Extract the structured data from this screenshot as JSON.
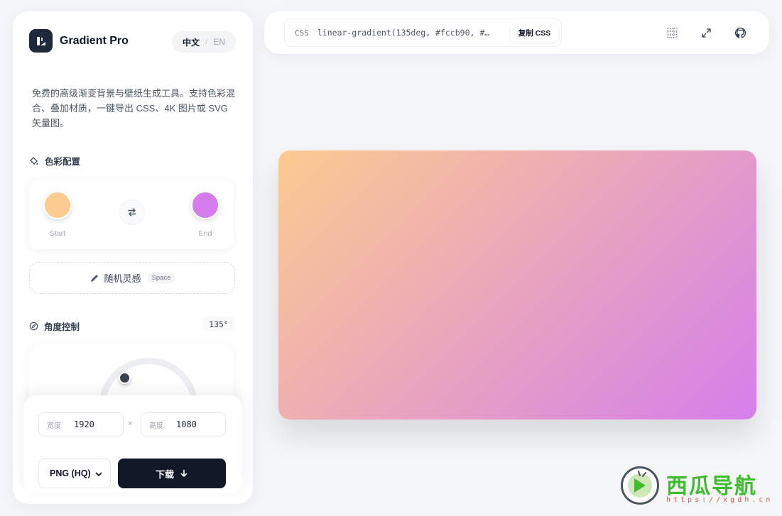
{
  "brand": {
    "name": "Gradient Pro"
  },
  "language": {
    "zh": "中文",
    "en": "EN",
    "active": "zh"
  },
  "description": "免费的高级渐变背景与壁纸生成工具。支持色彩混合、叠加材质，一键导出 CSS、4K 图片或 SVG 矢量图。",
  "color_config": {
    "title": "色彩配置",
    "start": {
      "label": "Start",
      "color": "#fccb90"
    },
    "end": {
      "label": "End",
      "color": "#d57eeb"
    }
  },
  "random": {
    "label": "随机灵感",
    "shortcut": "Space"
  },
  "angle": {
    "title": "角度控制",
    "value_text": "135°",
    "degrees": 135
  },
  "export": {
    "width_label": "宽度",
    "width_value": "1920",
    "height_label": "高度",
    "height_value": "1080",
    "times": "×",
    "format": "PNG (HQ)",
    "download_label": "下载"
  },
  "topbar": {
    "code_tag": "CSS",
    "code_text": "linear-gradient(135deg, #fccb90, #…",
    "copy_label": "复制 CSS"
  },
  "preview": {
    "gradient": "linear-gradient(135deg, #fccb90 0%, #d57eeb 100%)"
  },
  "watermark": {
    "title": "西瓜导航",
    "url": "https://xgdh.cn"
  },
  "icons": [
    "palette-icon",
    "swap-icon",
    "pencil-icon",
    "compass-icon",
    "chevron-down-icon",
    "arrow-down-icon",
    "grid-icon",
    "expand-icon",
    "github-icon"
  ]
}
